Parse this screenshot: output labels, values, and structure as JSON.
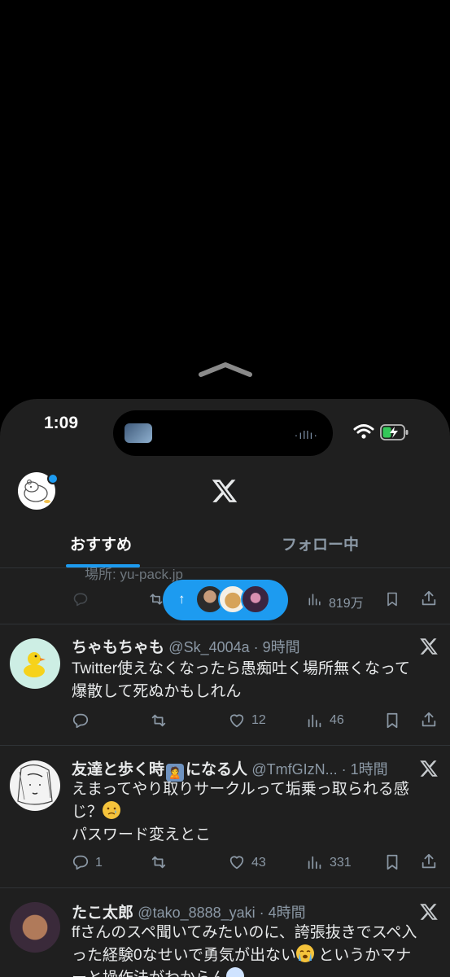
{
  "status_bar": {
    "time": "1:09"
  },
  "header": {
    "logo_icon": "x-logo-icon",
    "avatar_icon": "capybara-avatar-icon"
  },
  "tabs": [
    {
      "label": "おすすめ",
      "active": true
    },
    {
      "label": "フォロー中",
      "active": false
    }
  ],
  "partial_post": {
    "location": "場所: yu-pack.jp",
    "views": "819万"
  },
  "new_posts_pill": {
    "arrow": "↑",
    "avatars": 3
  },
  "tweets": [
    {
      "name": "ちゃもちゃも",
      "meta": "@Sk_4004a · 9時間",
      "lines": [
        "Twitter使えなくなったら愚痴吐く場所無くなって",
        "爆散して死ぬかもしれん"
      ],
      "replies": "",
      "retweets": "",
      "likes": "12",
      "views": "46"
    },
    {
      "name_before_badge": "友達と歩く時",
      "badge": "🙎",
      "name_after_badge": "になる人",
      "meta": "@TmfGIzN... · 1時間",
      "lines": [
        "えまってやり取りサークルって垢乗っ取られる感",
        "じ？",
        "パスワード変えとこ"
      ],
      "replies": "1",
      "retweets": "",
      "likes": "43",
      "views": "331"
    },
    {
      "name": "たこ太郎",
      "meta": "@tako_8888_yaki · 4時間",
      "lines": [
        "ffさんのスペ聞いてみたいのに、誇張抜きでスペ入",
        "った経験0なせいで勇気が出ない",
        "というかマナ",
        "ーと操作法がわからん"
      ]
    }
  ],
  "colors": {
    "accent": "#1d9bf0",
    "background": "#1f1f1f",
    "muted": "#8b98a5"
  }
}
